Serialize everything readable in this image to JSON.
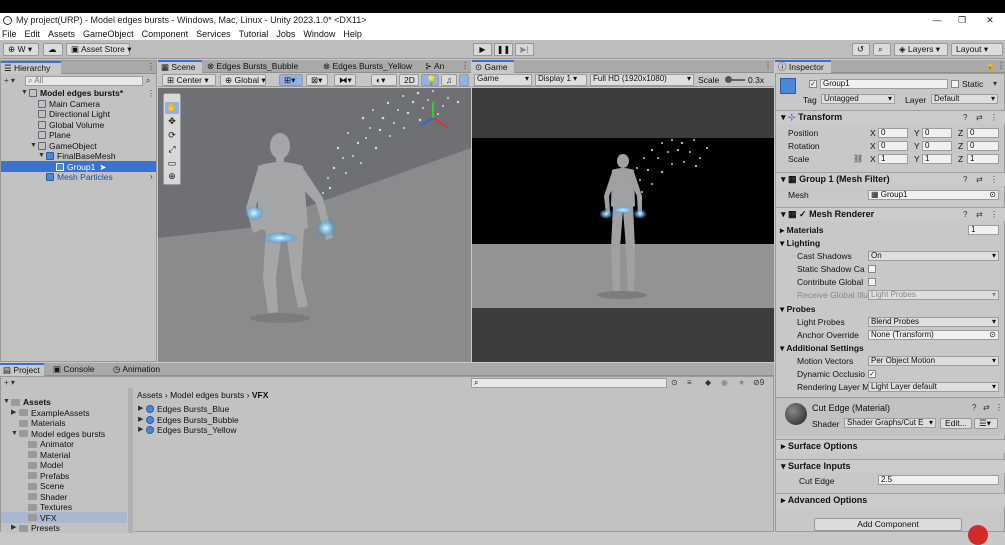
{
  "window": {
    "title": "My project(URP) - Model edges bursts - Windows, Mac, Linux - Unity 2023.1.0* <DX11>",
    "min": "—",
    "max": "❐",
    "close": "✕"
  },
  "menu": [
    "File",
    "Edit",
    "Assets",
    "GameObject",
    "Component",
    "Services",
    "Tutorial",
    "Jobs",
    "Window",
    "Help"
  ],
  "toolbar": {
    "account": "W",
    "asset_store": "Asset Store",
    "layers": "Layers",
    "layout": "Layout",
    "play": "▶",
    "pause": "❚❚",
    "step": "▶|"
  },
  "hierarchy": {
    "tab": "Hierarchy",
    "search_placeholder": "All",
    "scene": "Model edges bursts*",
    "items": [
      {
        "label": "Main Camera"
      },
      {
        "label": "Directional Light"
      },
      {
        "label": "Global Volume"
      },
      {
        "label": "Plane"
      },
      {
        "label": "GameObject"
      },
      {
        "label": "FinalBaseMesh"
      },
      {
        "label": "Group1"
      },
      {
        "label": "Mesh Particles"
      }
    ]
  },
  "scene_tabs": [
    "Scene",
    "Edges Bursts_Bubble",
    "Edges Bursts_Yellow",
    "An"
  ],
  "scene_toolbar": {
    "pivot": "Center",
    "space": "Global",
    "mode2d": "2D"
  },
  "game": {
    "tab": "Game",
    "view": "Game",
    "display": "Display 1",
    "resolution": "Full HD (1920x1080)",
    "scale_label": "Scale",
    "scale_value": "0.3x"
  },
  "bottom": {
    "tabs": [
      "Project",
      "Console",
      "Animation"
    ],
    "breadcrumb": [
      "Assets",
      "Model edges bursts",
      "VFX"
    ],
    "hidden_count": "9",
    "tree": [
      {
        "label": "Assets"
      },
      {
        "label": "ExampleAssets"
      },
      {
        "label": "Materials"
      },
      {
        "label": "Model edges bursts"
      },
      {
        "label": "Animator"
      },
      {
        "label": "Material"
      },
      {
        "label": "Model"
      },
      {
        "label": "Prefabs"
      },
      {
        "label": "Scene"
      },
      {
        "label": "Shader"
      },
      {
        "label": "Textures"
      },
      {
        "label": "VFX"
      },
      {
        "label": "Presets"
      }
    ],
    "files": [
      "Edges Bursts_Blue",
      "Edges Bursts_Bubble",
      "Edges Bursts_Yellow"
    ]
  },
  "inspector": {
    "tab": "Inspector",
    "name": "Group1",
    "static": "Static",
    "tag_label": "Tag",
    "tag": "Untagged",
    "layer_label": "Layer",
    "layer": "Default",
    "transform": {
      "title": "Transform",
      "rows": [
        {
          "label": "Position",
          "x": "0",
          "y": "0",
          "z": "0"
        },
        {
          "label": "Rotation",
          "x": "0",
          "y": "0",
          "z": "0"
        },
        {
          "label": "Scale",
          "x": "1",
          "y": "1",
          "z": "1"
        }
      ]
    },
    "axis": {
      "x": "X",
      "y": "Y",
      "z": "Z"
    },
    "mesh_filter": {
      "title": "Group 1 (Mesh Filter)",
      "mesh_label": "Mesh",
      "mesh": "Group1"
    },
    "mesh_renderer": {
      "title": "Mesh Renderer",
      "materials_label": "Materials",
      "materials_count": "1",
      "lighting": "Lighting",
      "cast_shadows_label": "Cast Shadows",
      "cast_shadows": "On",
      "static_shadow": "Static Shadow Ca",
      "contribute_gi": "Contribute Global",
      "receive_gi_label": "Receive Global Illu",
      "receive_gi": "Light Probes",
      "probes": "Probes",
      "light_probes_label": "Light Probes",
      "light_probes": "Blend Probes",
      "anchor_label": "Anchor Override",
      "anchor": "None (Transform)",
      "additional": "Additional Settings",
      "motion_label": "Motion Vectors",
      "motion": "Per Object Motion",
      "dynamic_occ": "Dynamic Occlusio",
      "rendering_layer_label": "Rendering Layer M",
      "rendering_layer": "Light Layer default"
    },
    "material": {
      "title": "Cut Edge (Material)",
      "shader_label": "Shader",
      "shader": "Shader Graphs/Cut E",
      "edit": "Edit...",
      "surface_options": "Surface Options",
      "surface_inputs": "Surface Inputs",
      "cut_edge_label": "Cut Edge",
      "cut_edge": "2.5",
      "advanced": "Advanced Options"
    },
    "add_component": "Add Component"
  },
  "colors": {
    "selection": "#3a72d0",
    "hierarchy_icon": "#4a87d9"
  }
}
